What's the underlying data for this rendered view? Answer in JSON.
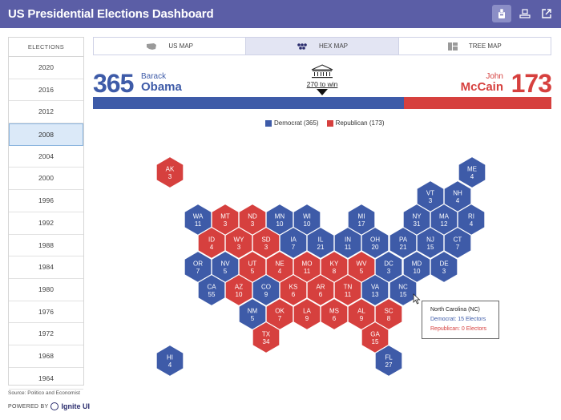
{
  "app": {
    "title": "US Presidential Elections Dashboard",
    "icons": [
      "ballot-icon",
      "vote-hand-icon",
      "external-link-icon"
    ]
  },
  "sidebar": {
    "header": "ELECTIONS",
    "years": [
      "2020",
      "2016",
      "2012",
      "2008",
      "2004",
      "2000",
      "1996",
      "1992",
      "1988",
      "1984",
      "1980",
      "1976",
      "1972",
      "1968",
      "1964"
    ],
    "selected": "2008"
  },
  "footer": {
    "source": "Source: Politico and Economist",
    "powered_by": "POWERED BY",
    "brand": "Ignite UI"
  },
  "tabs": [
    {
      "label": "US MAP",
      "icon": "us-map-icon"
    },
    {
      "label": "HEX MAP",
      "icon": "hex-map-icon"
    },
    {
      "label": "TREE MAP",
      "icon": "tree-map-icon"
    }
  ],
  "active_tab": "HEX MAP",
  "results": {
    "dem": {
      "votes": "365",
      "first": "Barack",
      "last": "Obama",
      "color": "#3e5ba8"
    },
    "rep": {
      "votes": "173",
      "first": "John",
      "last": "McCain",
      "color": "#d6403e"
    },
    "win_label": "270 to win",
    "dem_share": 0.678
  },
  "legend": [
    {
      "label": "Democrat (365)",
      "color": "#3e5ba8"
    },
    {
      "label": "Republican (173)",
      "color": "#d6403e"
    }
  ],
  "states": [
    {
      "abbr": "AK",
      "ev": "3",
      "party": "R"
    },
    {
      "abbr": "ME",
      "ev": "4",
      "party": "D"
    },
    {
      "abbr": "VT",
      "ev": "3",
      "party": "D"
    },
    {
      "abbr": "NH",
      "ev": "4",
      "party": "D"
    },
    {
      "abbr": "WA",
      "ev": "11",
      "party": "D"
    },
    {
      "abbr": "MT",
      "ev": "3",
      "party": "R"
    },
    {
      "abbr": "ND",
      "ev": "3",
      "party": "R"
    },
    {
      "abbr": "MN",
      "ev": "10",
      "party": "D"
    },
    {
      "abbr": "WI",
      "ev": "10",
      "party": "D"
    },
    {
      "abbr": "MI",
      "ev": "17",
      "party": "D"
    },
    {
      "abbr": "NY",
      "ev": "31",
      "party": "D"
    },
    {
      "abbr": "MA",
      "ev": "12",
      "party": "D"
    },
    {
      "abbr": "RI",
      "ev": "4",
      "party": "D"
    },
    {
      "abbr": "ID",
      "ev": "4",
      "party": "R"
    },
    {
      "abbr": "WY",
      "ev": "3",
      "party": "R"
    },
    {
      "abbr": "SD",
      "ev": "3",
      "party": "R"
    },
    {
      "abbr": "IA",
      "ev": "7",
      "party": "D"
    },
    {
      "abbr": "IL",
      "ev": "21",
      "party": "D"
    },
    {
      "abbr": "IN",
      "ev": "11",
      "party": "D"
    },
    {
      "abbr": "OH",
      "ev": "20",
      "party": "D"
    },
    {
      "abbr": "PA",
      "ev": "21",
      "party": "D"
    },
    {
      "abbr": "NJ",
      "ev": "15",
      "party": "D"
    },
    {
      "abbr": "CT",
      "ev": "7",
      "party": "D"
    },
    {
      "abbr": "OR",
      "ev": "7",
      "party": "D"
    },
    {
      "abbr": "NV",
      "ev": "5",
      "party": "D"
    },
    {
      "abbr": "UT",
      "ev": "5",
      "party": "R"
    },
    {
      "abbr": "NE",
      "ev": "4",
      "party": "R"
    },
    {
      "abbr": "MO",
      "ev": "11",
      "party": "R"
    },
    {
      "abbr": "KY",
      "ev": "8",
      "party": "R"
    },
    {
      "abbr": "WV",
      "ev": "5",
      "party": "R"
    },
    {
      "abbr": "DC",
      "ev": "3",
      "party": "D"
    },
    {
      "abbr": "MD",
      "ev": "10",
      "party": "D"
    },
    {
      "abbr": "DE",
      "ev": "3",
      "party": "D"
    },
    {
      "abbr": "CA",
      "ev": "55",
      "party": "D"
    },
    {
      "abbr": "AZ",
      "ev": "10",
      "party": "R"
    },
    {
      "abbr": "CO",
      "ev": "9",
      "party": "D"
    },
    {
      "abbr": "KS",
      "ev": "6",
      "party": "R"
    },
    {
      "abbr": "AR",
      "ev": "6",
      "party": "R"
    },
    {
      "abbr": "TN",
      "ev": "11",
      "party": "R"
    },
    {
      "abbr": "VA",
      "ev": "13",
      "party": "D"
    },
    {
      "abbr": "NC",
      "ev": "15",
      "party": "D"
    },
    {
      "abbr": "NM",
      "ev": "5",
      "party": "D"
    },
    {
      "abbr": "OK",
      "ev": "7",
      "party": "R"
    },
    {
      "abbr": "LA",
      "ev": "9",
      "party": "R"
    },
    {
      "abbr": "MS",
      "ev": "6",
      "party": "R"
    },
    {
      "abbr": "AL",
      "ev": "9",
      "party": "R"
    },
    {
      "abbr": "SC",
      "ev": "8",
      "party": "R"
    },
    {
      "abbr": "TX",
      "ev": "34",
      "party": "R"
    },
    {
      "abbr": "GA",
      "ev": "15",
      "party": "R"
    },
    {
      "abbr": "HI",
      "ev": "4",
      "party": "D"
    },
    {
      "abbr": "FL",
      "ev": "27",
      "party": "D"
    }
  ],
  "tooltip": {
    "title": "North Carolina (NC)",
    "dem": "Democrat: 15 Electors",
    "rep": "Republican: 0 Electors"
  }
}
